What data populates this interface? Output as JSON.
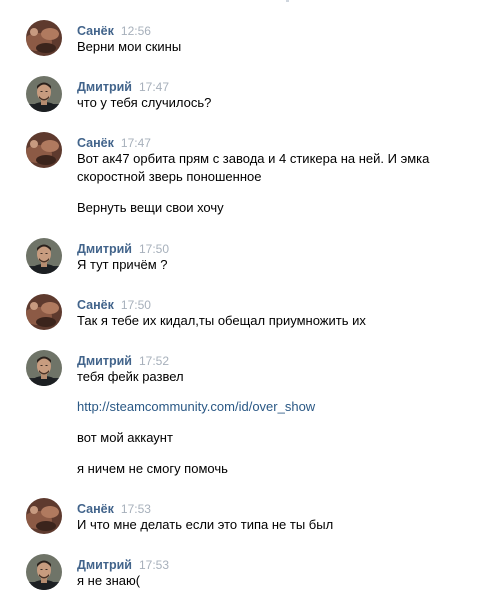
{
  "messages": [
    {
      "author": "Санёк",
      "time": "12:56",
      "avatar": "sanek-avatar",
      "lines": [
        "Верни мои скины"
      ]
    },
    {
      "author": "Дмитрий",
      "time": "17:47",
      "avatar": "dmitry-avatar",
      "lines": [
        "что у тебя случилось?"
      ]
    },
    {
      "author": "Санёк",
      "time": "17:47",
      "avatar": "sanek-avatar",
      "lines": [
        "Вот ак47 орбита прям с завода и 4 стикера на ней. И эмка",
        "скоростной зверь поношенное",
        "Вернуть вещи свои хочу"
      ]
    },
    {
      "author": "Дмитрий",
      "time": "17:50",
      "avatar": "dmitry-avatar",
      "lines": [
        "Я тут причём ?"
      ]
    },
    {
      "author": "Санёк",
      "time": "17:50",
      "avatar": "sanek-avatar",
      "lines": [
        "Так я тебе их кидал,ты обещал приумножить их"
      ]
    },
    {
      "author": "Дмитрий",
      "time": "17:52",
      "avatar": "dmitry-avatar",
      "lines": [
        "тебя фейк развел",
        "http://steamcommunity.com/id/over_show",
        "вот мой аккаунт",
        "я ничем не смогу помочь"
      ]
    },
    {
      "author": "Санёк",
      "time": "17:53",
      "avatar": "sanek-avatar",
      "lines": [
        "И что мне делать если это типа не ты был"
      ]
    },
    {
      "author": "Дмитрий",
      "time": "17:53",
      "avatar": "dmitry-avatar",
      "lines": [
        "я не знаю("
      ]
    }
  ],
  "colors": {
    "author": "#42648b",
    "time": "#a7b0bb",
    "link": "#2a5885",
    "text": "#000000"
  }
}
